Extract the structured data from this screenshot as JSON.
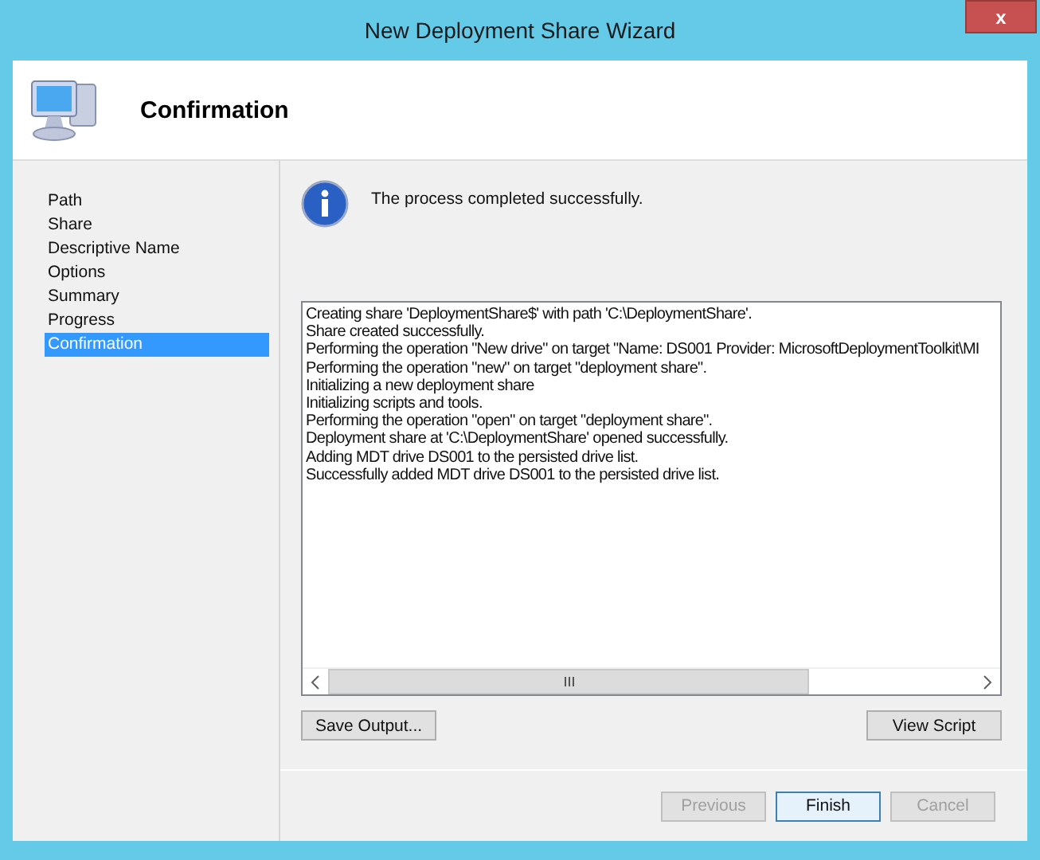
{
  "window": {
    "title": "New Deployment Share Wizard",
    "close": "x"
  },
  "header": {
    "title": "Confirmation"
  },
  "sidebar": {
    "items": [
      {
        "label": "Path",
        "selected": false
      },
      {
        "label": "Share",
        "selected": false
      },
      {
        "label": "Descriptive Name",
        "selected": false
      },
      {
        "label": "Options",
        "selected": false
      },
      {
        "label": "Summary",
        "selected": false
      },
      {
        "label": "Progress",
        "selected": false
      },
      {
        "label": "Confirmation",
        "selected": true
      }
    ]
  },
  "message": "The process completed successfully.",
  "log": {
    "lines": [
      "Creating share 'DeploymentShare$' with path 'C:\\DeploymentShare'.",
      "Share created successfully.",
      "Performing the operation \"New drive\" on target \"Name: DS001 Provider: MicrosoftDeploymentToolkit\\MI",
      "Performing the operation \"new\" on target \"deployment share\".",
      "Initializing a new deployment share",
      "Initializing scripts and tools.",
      "Performing the operation \"open\" on target \"deployment share\".",
      "Deployment share at 'C:\\DeploymentShare' opened successfully.",
      "Adding MDT drive DS001 to the persisted drive list.",
      "Successfully added MDT drive DS001 to the persisted drive list."
    ]
  },
  "log_buttons": [
    {
      "label": "Save Output..."
    },
    {
      "label": "View Script"
    }
  ],
  "buttons": [
    {
      "label": "Previous",
      "disabled": true,
      "default": false
    },
    {
      "label": "Finish",
      "disabled": false,
      "default": true
    },
    {
      "label": "Cancel",
      "disabled": true,
      "default": false
    }
  ]
}
